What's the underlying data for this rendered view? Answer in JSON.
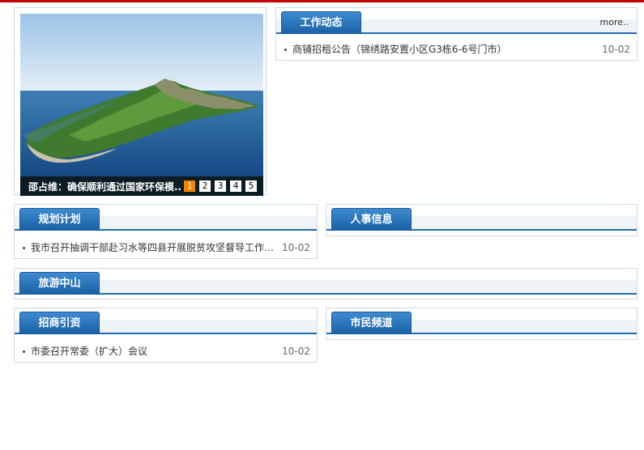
{
  "slideshow": {
    "caption": "邵占维：确保顺利通过国家环保模...",
    "pages": [
      "1",
      "2",
      "3",
      "4",
      "5"
    ],
    "active_page": 1,
    "colors": {
      "active": "#f08300",
      "caption_bg": "#0d1b24"
    }
  },
  "sections": {
    "work_news": {
      "title": "工作动态",
      "more": "more..",
      "items": [
        {
          "title": "商铺招租公告（锦绣路安置小区G3栋6-6号门市）",
          "date": "10-02"
        }
      ]
    },
    "planning": {
      "title": "规划计划",
      "items": [
        {
          "title": "我市召开抽调干部赴习水等四县开展脱贫攻坚督导工作座...",
          "date": "10-02"
        }
      ]
    },
    "personnel": {
      "title": "人事信息",
      "items": []
    },
    "tourism": {
      "title": "旅游中山"
    },
    "investment": {
      "title": "招商引资",
      "items": [
        {
          "title": "市委召开常委（扩大）会议",
          "date": "10-02"
        }
      ]
    },
    "citizens": {
      "title": "市民频道",
      "items": []
    }
  },
  "colors": {
    "accent": "#1f6fb2",
    "top_bar": "#c40000"
  }
}
